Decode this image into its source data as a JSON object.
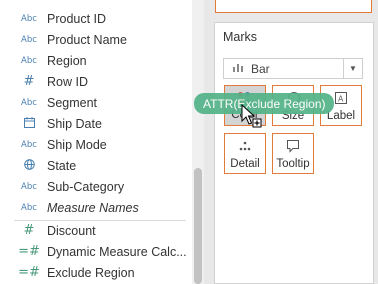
{
  "data_pane": {
    "fields": [
      {
        "icon": "Abc",
        "label": "Product ID",
        "italic": false
      },
      {
        "icon": "Abc",
        "label": "Product Name",
        "italic": false
      },
      {
        "icon": "Abc",
        "label": "Region",
        "italic": false
      },
      {
        "icon": "#",
        "label": "Row ID",
        "italic": false
      },
      {
        "icon": "Abc",
        "label": "Segment",
        "italic": false
      },
      {
        "icon": "calendar",
        "label": "Ship Date",
        "italic": false
      },
      {
        "icon": "Abc",
        "label": "Ship Mode",
        "italic": false
      },
      {
        "icon": "globe",
        "label": "State",
        "italic": false
      },
      {
        "icon": "Abc",
        "label": "Sub-Category",
        "italic": false
      },
      {
        "icon": "Abc",
        "label": "Measure Names",
        "italic": true
      }
    ],
    "measures": [
      {
        "icon": "#",
        "label": "Discount"
      },
      {
        "icon": "=#",
        "label": "Dynamic Measure Calc..."
      },
      {
        "icon": "=#",
        "label": "Exclude Region"
      }
    ]
  },
  "marks": {
    "title": "Marks",
    "mark_type": "Bar",
    "buttons": {
      "color": "Color",
      "size": "Size",
      "label": "Label",
      "detail": "Detail",
      "tooltip": "Tooltip"
    }
  },
  "drag_pill": {
    "label": "ATTR(Exclude Region)"
  },
  "colors": {
    "accent": "#e07b3a",
    "pill": "#54b389",
    "dimension_icon": "#4a7fb0",
    "measure_icon": "#4a9a7a"
  }
}
